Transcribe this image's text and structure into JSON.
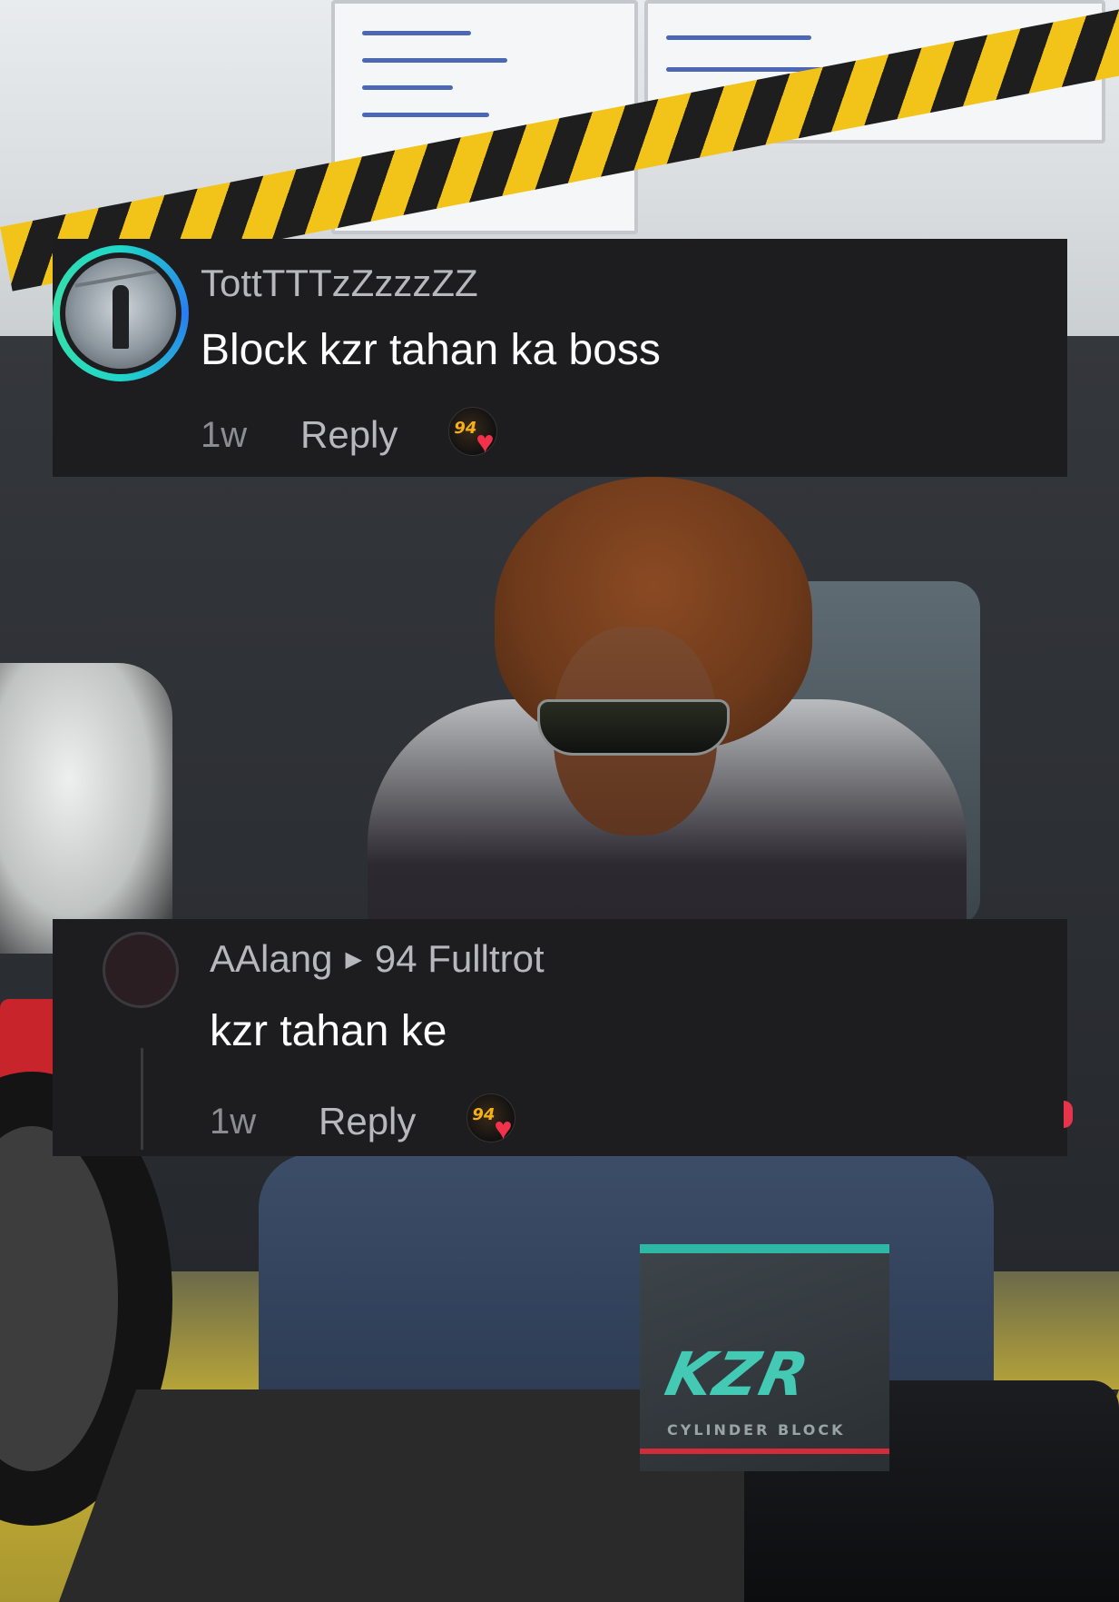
{
  "comments": [
    {
      "username": "TottTTTzZzzzZZ",
      "text": "Block kzr tahan ka boss",
      "time": "1w",
      "reply_label": "Reply",
      "creator_like_badge": "94"
    },
    {
      "username": "AAlang",
      "reply_to": "94 Fulltrot",
      "text": "kzr tahan ke",
      "time": "1w",
      "reply_label": "Reply",
      "creator_like_badge": "94"
    }
  ],
  "product_box": {
    "brand": "KZR",
    "subtitle": "CYLINDER BLOCK"
  },
  "colors": {
    "comment_bg": "#1d1d1f",
    "like_heart": "#f2314a",
    "avatar_ring": "#20d6c8"
  },
  "icons": {
    "heart": "heart-icon",
    "reply_arrow": "triangle-right-icon"
  }
}
